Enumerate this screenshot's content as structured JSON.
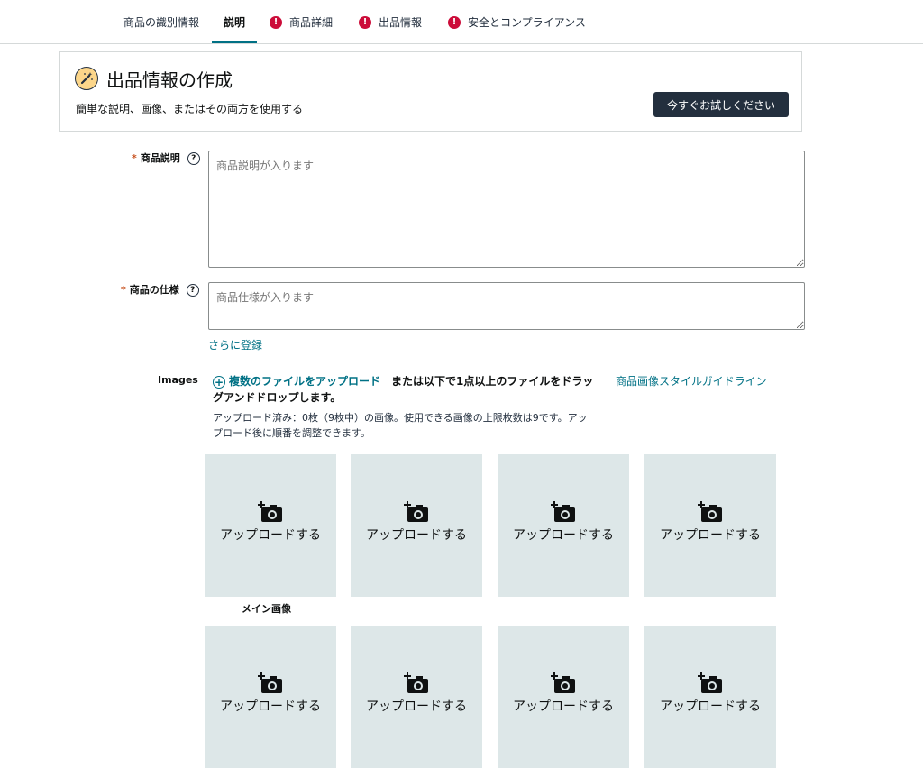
{
  "tabs": [
    {
      "label": "商品の識別情報",
      "error": false
    },
    {
      "label": "説明",
      "error": false,
      "active": true
    },
    {
      "label": "商品詳細",
      "error": true
    },
    {
      "label": "出品情報",
      "error": true
    },
    {
      "label": "安全とコンプライアンス",
      "error": true
    }
  ],
  "error_glyph": "!",
  "promo": {
    "icon": "magic-wand-icon",
    "title": "出品情報の作成",
    "subtitle": "簡単な説明、画像、またはその両方を使用する",
    "button": "今すぐお試しください"
  },
  "fields": {
    "required_mark": "*",
    "help_glyph": "?",
    "description": {
      "label": "商品説明",
      "placeholder": "商品説明が入ります",
      "value": ""
    },
    "spec": {
      "label": "商品の仕様",
      "placeholder": "商品仕様が入ります",
      "value": ""
    },
    "add_more": "さらに登録"
  },
  "images": {
    "label": "Images",
    "upload_link": "複数のファイルをアップロード",
    "upload_rest": "または以下で1点以上のファイルをドラッグアンドドロップします。",
    "style_guide": "商品画像スタイルガイドライン",
    "note": "アップロード済み：0枚（9枚中）の画像。使用できる画像の上限枚数は9です。アップロード後に順番を調整できます。",
    "tile_label": "アップロードする",
    "main_label": "メイン画像"
  },
  "colors": {
    "accent": "#007185",
    "error": "#cc0c39",
    "dark_button": "#232f3e",
    "tile_bg": "#dde7e8"
  }
}
